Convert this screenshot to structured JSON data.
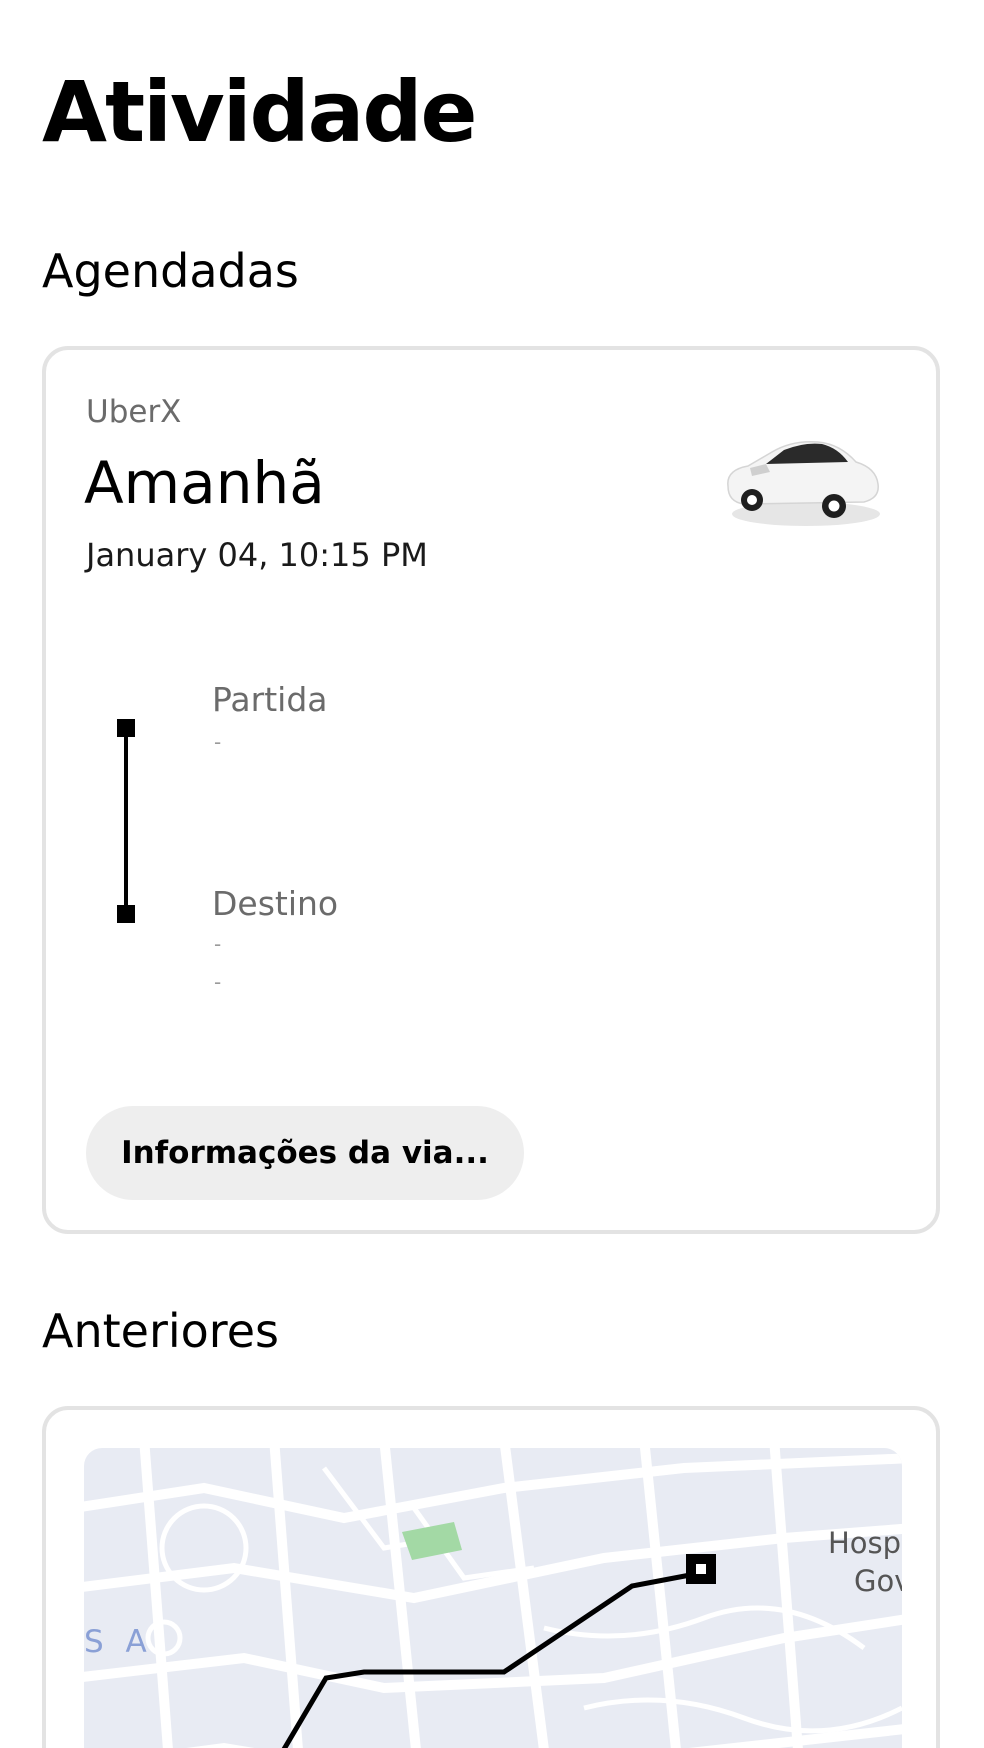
{
  "header": {
    "title": "Atividade"
  },
  "upcoming": {
    "section_title": "Agendadas",
    "trip": {
      "product": "UberX",
      "day": "Amanhã",
      "datetime": "January 04, 10:15 PM",
      "pickup_label": "Partida",
      "pickup_value": "-",
      "dropoff_label": "Destino",
      "dropoff_value_line1": "-",
      "dropoff_value_line2": "-",
      "details_button_label": "Informações da via...",
      "vehicle_icon": "car-icon"
    }
  },
  "past": {
    "section_title": "Anteriores",
    "map": {
      "label_left": "S A",
      "label_right_line1": "Hosp",
      "label_right_line2": "Gov",
      "colors": {
        "background": "#e8ebf3",
        "roads": "#ffffff",
        "park": "#a3d9a5",
        "route": "#000000",
        "label_blue": "#8aa0d6"
      }
    }
  },
  "colors": {
    "card_border": "#e3e3e3",
    "button_bg": "#eeeeee",
    "secondary_text": "#6b6b6b"
  }
}
